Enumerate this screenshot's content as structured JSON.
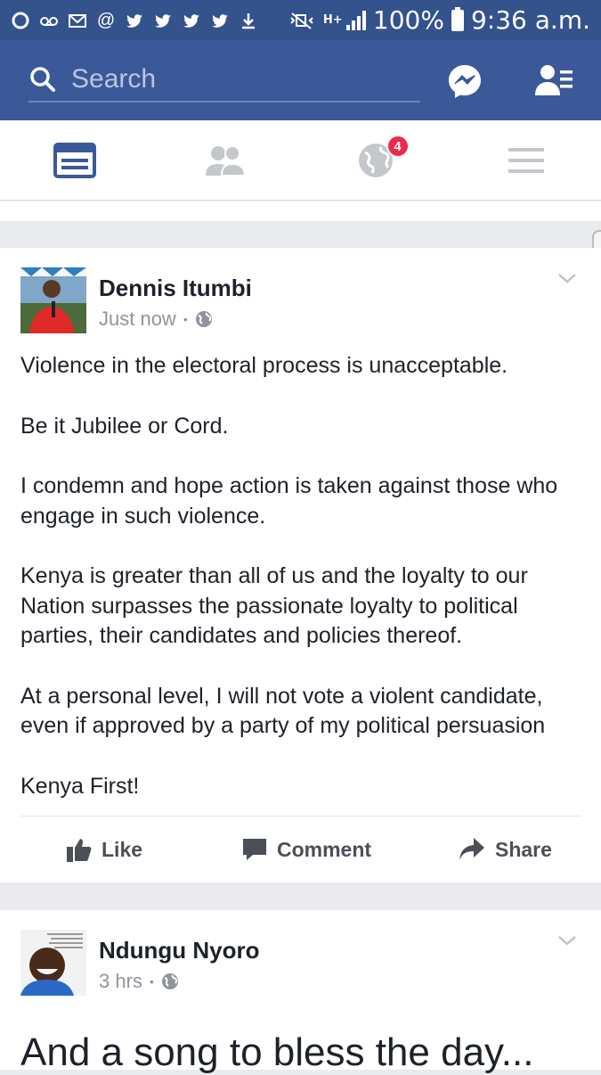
{
  "status_bar": {
    "battery": "100%",
    "time": "9:36 a.m.",
    "network": "H+",
    "icons": [
      "circle-icon",
      "recorder-icon",
      "mail-icon",
      "at-icon",
      "twitter-icon",
      "twitter-icon",
      "twitter-icon",
      "twitter-icon",
      "download-icon",
      "mute-icon",
      "signal-icon",
      "battery-icon"
    ]
  },
  "header": {
    "search_placeholder": "Search",
    "icons": [
      "search-icon",
      "messenger-icon",
      "friend-requests-icon"
    ]
  },
  "tabs": [
    {
      "name": "news-feed",
      "icon": "news-feed-icon",
      "active": true
    },
    {
      "name": "friends",
      "icon": "friends-icon",
      "active": false
    },
    {
      "name": "notifications",
      "icon": "globe-icon",
      "active": false,
      "badge": "4"
    },
    {
      "name": "menu",
      "icon": "menu-icon",
      "active": false
    }
  ],
  "posts": [
    {
      "author": "Dennis Itumbi",
      "time": "Just now",
      "audience_icon": "globe-icon",
      "paragraphs": [
        "Violence in the electoral process is unacceptable.",
        "Be it Jubilee or Cord.",
        "I condemn and hope action is taken against those who engage in such violence.",
        "Kenya is greater than all of us and the loyalty to our Nation surpasses the passionate loyalty to political parties, their candidates and policies thereof.",
        "At a personal level, I will not vote a violent candidate, even if approved by a party of my political persuasion",
        "Kenya First!"
      ],
      "actions": {
        "like": "Like",
        "comment": "Comment",
        "share": "Share"
      }
    },
    {
      "author": "Ndungu Nyoro",
      "time": "3 hrs",
      "audience_icon": "globe-icon",
      "text": "And a song to bless the day..."
    }
  ],
  "colors": {
    "brand": "#3b5998",
    "status_bar": "#34528c",
    "badge": "#f02849",
    "muted": "#90949c"
  }
}
